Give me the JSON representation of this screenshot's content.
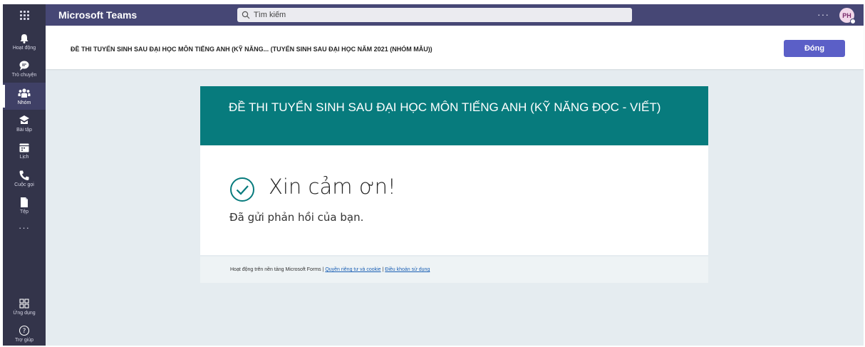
{
  "topbar": {
    "app_title": "Microsoft Teams",
    "search_placeholder": "Tìm kiếm",
    "more": "···",
    "avatar_initials": "PH"
  },
  "rail": {
    "items": [
      {
        "label": "Hoạt động",
        "icon": "bell-icon"
      },
      {
        "label": "Trò chuyện",
        "icon": "chat-icon"
      },
      {
        "label": "Nhóm",
        "icon": "teams-icon",
        "active": true
      },
      {
        "label": "Bài tập",
        "icon": "assignments-icon"
      },
      {
        "label": "Lịch",
        "icon": "calendar-icon"
      },
      {
        "label": "Cuộc gọi",
        "icon": "phone-icon"
      },
      {
        "label": "Tệp",
        "icon": "file-icon"
      }
    ],
    "more": "···",
    "apps_label": "Ứng dụng",
    "help_label": "Trợ giúp"
  },
  "header": {
    "title": "ĐỀ THI TUYỂN SINH SAU ĐẠI HỌC MÔN TIẾNG ANH (KỸ NĂNG... (TUYỂN SINH SAU ĐẠI HỌC NĂM 2021 (NHÓM MẪU))",
    "close_label": "Đóng"
  },
  "form": {
    "title": "ĐỀ THI TUYỂN SINH SAU ĐẠI HỌC MÔN TIẾNG ANH (KỸ NĂNG ĐỌC - VIẾT)",
    "thanks": "Xin cảm ơn!",
    "submitted": "Đã gửi phản hồi của bạn."
  },
  "footer": {
    "powered": "Hoạt động trên nền tảng Microsoft Forms | ",
    "privacy": "Quyền riêng tư và cookie",
    "sep": " | ",
    "terms": "Điều khoản sử dụng"
  },
  "colors": {
    "topbar": "#464775",
    "rail": "#33344a",
    "accent": "#5b5fc7",
    "form_header": "#077b7d",
    "background": "#e5ecf0"
  }
}
